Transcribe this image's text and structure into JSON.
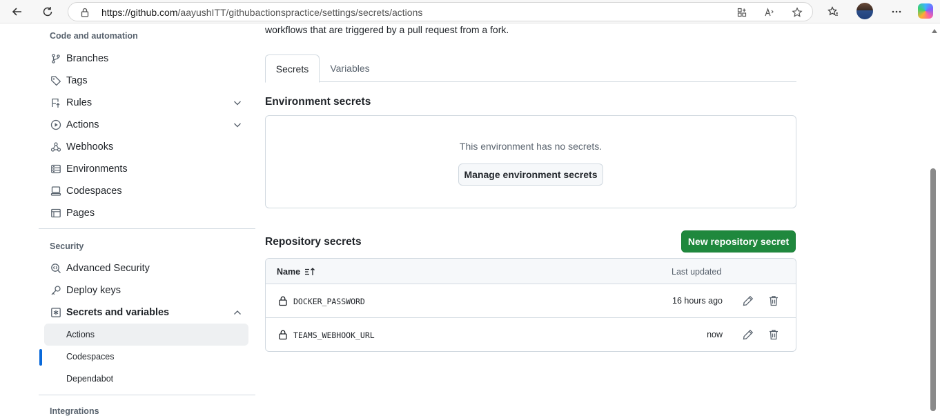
{
  "browser": {
    "url_host": "https://github.com",
    "url_path": "/aayushITT/githubactionspractice/settings/secrets/actions"
  },
  "sidebar": {
    "code_automation_title": "Code and automation",
    "items": [
      {
        "label": "Branches"
      },
      {
        "label": "Tags"
      },
      {
        "label": "Rules"
      },
      {
        "label": "Actions"
      },
      {
        "label": "Webhooks"
      },
      {
        "label": "Environments"
      },
      {
        "label": "Codespaces"
      },
      {
        "label": "Pages"
      }
    ],
    "security_title": "Security",
    "security_items": [
      {
        "label": "Advanced Security"
      },
      {
        "label": "Deploy keys"
      },
      {
        "label": "Secrets and variables"
      }
    ],
    "sub_items": [
      {
        "label": "Actions"
      },
      {
        "label": "Codespaces"
      },
      {
        "label": "Dependabot"
      }
    ],
    "integrations_title": "Integrations"
  },
  "main": {
    "intro_text": "workflows that are triggered by a pull request from a fork.",
    "tabs": [
      {
        "label": "Secrets"
      },
      {
        "label": "Variables"
      }
    ],
    "env_secrets": {
      "title": "Environment secrets",
      "empty_message": "This environment has no secrets.",
      "manage_button": "Manage environment secrets"
    },
    "repo_secrets": {
      "title": "Repository secrets",
      "new_button": "New repository secret",
      "col_name": "Name",
      "col_updated": "Last updated",
      "rows": [
        {
          "name": "DOCKER_PASSWORD",
          "updated": "16 hours ago"
        },
        {
          "name": "TEAMS_WEBHOOK_URL",
          "updated": "now"
        }
      ]
    }
  }
}
